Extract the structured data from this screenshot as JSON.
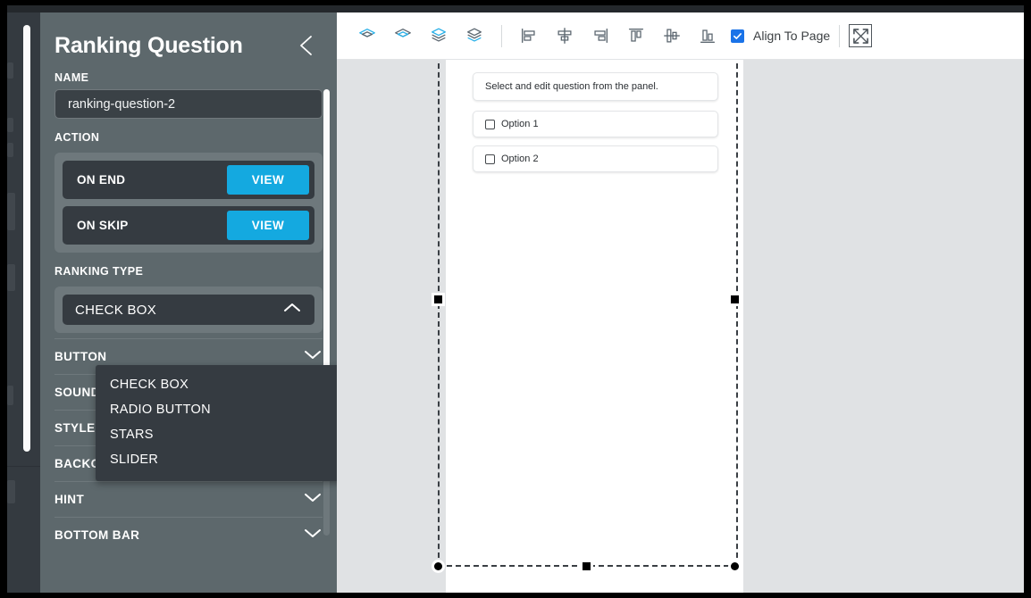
{
  "sidebar": {
    "title": "Ranking Question",
    "collapse_icon": "chevron-left-icon",
    "name_label": "NAME",
    "name_value": "ranking-question-2",
    "action_label": "ACTION",
    "actions": [
      {
        "label": "ON END",
        "button": "VIEW"
      },
      {
        "label": "ON SKIP",
        "button": "VIEW"
      }
    ],
    "ranking_type_label": "RANKING TYPE",
    "ranking_type_selected": "CHECK BOX",
    "ranking_type_caret": "chevron-up-icon",
    "ranking_type_options": [
      "CHECK BOX",
      "RADIO BUTTON",
      "STARS",
      "SLIDER"
    ],
    "sections": [
      {
        "title": "BUTTON",
        "caret": "chevron-down-icon"
      },
      {
        "title": "SOUND",
        "caret": "chevron-down-icon"
      },
      {
        "title": "STYLE",
        "caret": "chevron-down-icon"
      },
      {
        "title": "BACKGROUND STYLE",
        "caret": "chevron-down-icon"
      },
      {
        "title": "HINT",
        "caret": "chevron-down-icon"
      },
      {
        "title": "BOTTOM BAR",
        "caret": "chevron-down-icon"
      }
    ]
  },
  "toolbar": {
    "layer_buttons": [
      {
        "name": "bring-to-front-icon"
      },
      {
        "name": "bring-forward-icon"
      },
      {
        "name": "send-backward-icon"
      },
      {
        "name": "send-to-back-icon"
      }
    ],
    "align_buttons": [
      {
        "name": "align-left-icon"
      },
      {
        "name": "align-center-horizontal-icon"
      },
      {
        "name": "align-right-icon"
      },
      {
        "name": "align-top-icon"
      },
      {
        "name": "align-middle-vertical-icon"
      },
      {
        "name": "align-bottom-icon"
      }
    ],
    "align_to_page_label": "Align To Page",
    "align_to_page_checked": true,
    "fit_icon": "fit-to-screen-icon"
  },
  "canvas": {
    "question_text": "Select and edit question from the panel.",
    "options": [
      {
        "label": "Option 1",
        "checked": false
      },
      {
        "label": "Option 2",
        "checked": false
      }
    ]
  },
  "colors": {
    "accent_blue": "#14a9e0",
    "checkbox_blue": "#1a73e8",
    "sidebar_bg": "#5d686c",
    "sidebar_field": "#353b41",
    "canvas_bg": "#e0e2e4"
  }
}
